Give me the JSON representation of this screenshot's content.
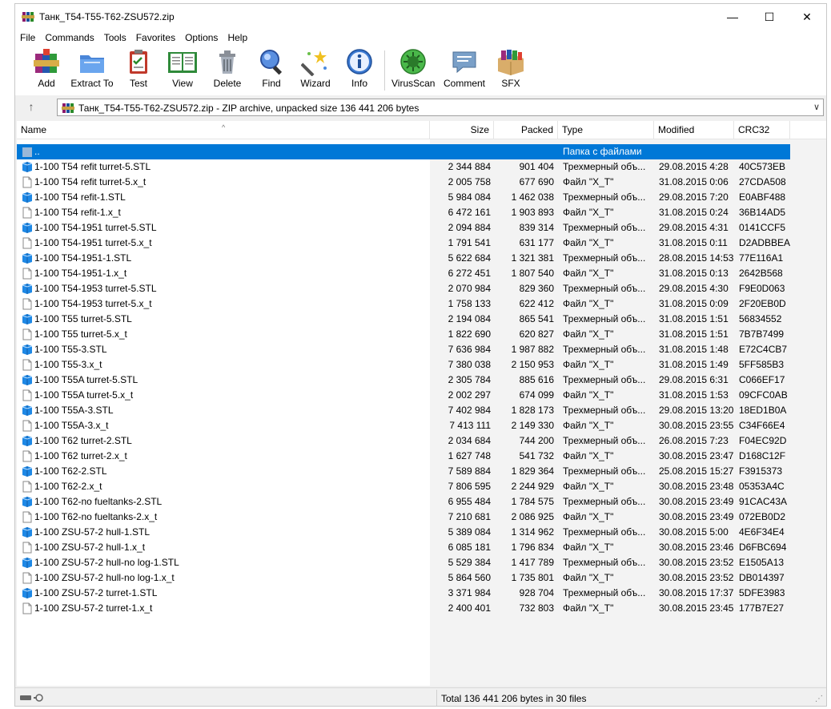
{
  "window": {
    "title": "Танк_T54-T55-T62-ZSU572.zip",
    "minimize": "—",
    "maximize": "☐",
    "close": "✕"
  },
  "menu": [
    "File",
    "Commands",
    "Tools",
    "Favorites",
    "Options",
    "Help"
  ],
  "toolbar": [
    {
      "label": "Add",
      "icon": "add-archive-icon"
    },
    {
      "label": "Extract To",
      "icon": "extract-folder-icon"
    },
    {
      "label": "Test",
      "icon": "test-clipboard-icon"
    },
    {
      "label": "View",
      "icon": "view-book-icon"
    },
    {
      "label": "Delete",
      "icon": "trash-icon"
    },
    {
      "label": "Find",
      "icon": "magnifier-icon"
    },
    {
      "label": "Wizard",
      "icon": "wizard-wand-icon"
    },
    {
      "label": "Info",
      "icon": "info-icon"
    },
    {
      "label": "VirusScan",
      "icon": "virus-scan-icon"
    },
    {
      "label": "Comment",
      "icon": "comment-icon"
    },
    {
      "label": "SFX",
      "icon": "sfx-box-icon"
    }
  ],
  "address": {
    "text": "Танк_T54-T55-T62-ZSU572.zip - ZIP archive, unpacked size 136 441 206 bytes"
  },
  "columns": {
    "name": "Name",
    "size": "Size",
    "packed": "Packed",
    "type": "Type",
    "modified": "Modified",
    "crc": "CRC32"
  },
  "parent_row": {
    "name": "..",
    "type": "Папка с файлами"
  },
  "files": [
    {
      "name": "1-100 T54 refit turret-5.STL",
      "size": "2 344 884",
      "packed": "901 404",
      "type": "Трехмерный объ...",
      "modified": "29.08.2015 4:28",
      "crc": "40C573EB",
      "kind": "stl"
    },
    {
      "name": "1-100 T54 refit turret-5.x_t",
      "size": "2 005 758",
      "packed": "677 690",
      "type": "Файл \"X_T\"",
      "modified": "31.08.2015 0:06",
      "crc": "27CDA508",
      "kind": "xt"
    },
    {
      "name": "1-100 T54 refit-1.STL",
      "size": "5 984 084",
      "packed": "1 462 038",
      "type": "Трехмерный объ...",
      "modified": "29.08.2015 7:20",
      "crc": "E0ABF488",
      "kind": "stl"
    },
    {
      "name": "1-100 T54 refit-1.x_t",
      "size": "6 472 161",
      "packed": "1 903 893",
      "type": "Файл \"X_T\"",
      "modified": "31.08.2015 0:24",
      "crc": "36B14AD5",
      "kind": "xt"
    },
    {
      "name": "1-100 T54-1951 turret-5.STL",
      "size": "2 094 884",
      "packed": "839 314",
      "type": "Трехмерный объ...",
      "modified": "29.08.2015 4:31",
      "crc": "0141CCF5",
      "kind": "stl"
    },
    {
      "name": "1-100 T54-1951 turret-5.x_t",
      "size": "1 791 541",
      "packed": "631 177",
      "type": "Файл \"X_T\"",
      "modified": "31.08.2015 0:11",
      "crc": "D2ADBBEA",
      "kind": "xt"
    },
    {
      "name": "1-100 T54-1951-1.STL",
      "size": "5 622 684",
      "packed": "1 321 381",
      "type": "Трехмерный объ...",
      "modified": "28.08.2015 14:53",
      "crc": "77E116A1",
      "kind": "stl"
    },
    {
      "name": "1-100 T54-1951-1.x_t",
      "size": "6 272 451",
      "packed": "1 807 540",
      "type": "Файл \"X_T\"",
      "modified": "31.08.2015 0:13",
      "crc": "2642B568",
      "kind": "xt"
    },
    {
      "name": "1-100 T54-1953 turret-5.STL",
      "size": "2 070 984",
      "packed": "829 360",
      "type": "Трехмерный объ...",
      "modified": "29.08.2015 4:30",
      "crc": "F9E0D063",
      "kind": "stl"
    },
    {
      "name": "1-100 T54-1953 turret-5.x_t",
      "size": "1 758 133",
      "packed": "622 412",
      "type": "Файл \"X_T\"",
      "modified": "31.08.2015 0:09",
      "crc": "2F20EB0D",
      "kind": "xt"
    },
    {
      "name": "1-100 T55 turret-5.STL",
      "size": "2 194 084",
      "packed": "865 541",
      "type": "Трехмерный объ...",
      "modified": "31.08.2015 1:51",
      "crc": "56834552",
      "kind": "stl"
    },
    {
      "name": "1-100 T55 turret-5.x_t",
      "size": "1 822 690",
      "packed": "620 827",
      "type": "Файл \"X_T\"",
      "modified": "31.08.2015 1:51",
      "crc": "7B7B7499",
      "kind": "xt"
    },
    {
      "name": "1-100 T55-3.STL",
      "size": "7 636 984",
      "packed": "1 987 882",
      "type": "Трехмерный объ...",
      "modified": "31.08.2015 1:48",
      "crc": "E72C4CB7",
      "kind": "stl"
    },
    {
      "name": "1-100 T55-3.x_t",
      "size": "7 380 038",
      "packed": "2 150 953",
      "type": "Файл \"X_T\"",
      "modified": "31.08.2015 1:49",
      "crc": "5FF585B3",
      "kind": "xt"
    },
    {
      "name": "1-100 T55A turret-5.STL",
      "size": "2 305 784",
      "packed": "885 616",
      "type": "Трехмерный объ...",
      "modified": "29.08.2015 6:31",
      "crc": "C066EF17",
      "kind": "stl"
    },
    {
      "name": "1-100 T55A turret-5.x_t",
      "size": "2 002 297",
      "packed": "674 099",
      "type": "Файл \"X_T\"",
      "modified": "31.08.2015 1:53",
      "crc": "09CFC0AB",
      "kind": "xt"
    },
    {
      "name": "1-100 T55A-3.STL",
      "size": "7 402 984",
      "packed": "1 828 173",
      "type": "Трехмерный объ...",
      "modified": "29.08.2015 13:20",
      "crc": "18ED1B0A",
      "kind": "stl"
    },
    {
      "name": "1-100 T55A-3.x_t",
      "size": "7 413 111",
      "packed": "2 149 330",
      "type": "Файл \"X_T\"",
      "modified": "30.08.2015 23:55",
      "crc": "C34F66E4",
      "kind": "xt"
    },
    {
      "name": "1-100 T62 turret-2.STL",
      "size": "2 034 684",
      "packed": "744 200",
      "type": "Трехмерный объ...",
      "modified": "26.08.2015 7:23",
      "crc": "F04EC92D",
      "kind": "stl"
    },
    {
      "name": "1-100 T62 turret-2.x_t",
      "size": "1 627 748",
      "packed": "541 732",
      "type": "Файл \"X_T\"",
      "modified": "30.08.2015 23:47",
      "crc": "D168C12F",
      "kind": "xt"
    },
    {
      "name": "1-100 T62-2.STL",
      "size": "7 589 884",
      "packed": "1 829 364",
      "type": "Трехмерный объ...",
      "modified": "25.08.2015 15:27",
      "crc": "F3915373",
      "kind": "stl"
    },
    {
      "name": "1-100 T62-2.x_t",
      "size": "7 806 595",
      "packed": "2 244 929",
      "type": "Файл \"X_T\"",
      "modified": "30.08.2015 23:48",
      "crc": "05353A4C",
      "kind": "xt"
    },
    {
      "name": "1-100 T62-no fueltanks-2.STL",
      "size": "6 955 484",
      "packed": "1 784 575",
      "type": "Трехмерный объ...",
      "modified": "30.08.2015 23:49",
      "crc": "91CAC43A",
      "kind": "stl"
    },
    {
      "name": "1-100 T62-no fueltanks-2.x_t",
      "size": "7 210 681",
      "packed": "2 086 925",
      "type": "Файл \"X_T\"",
      "modified": "30.08.2015 23:49",
      "crc": "072EB0D2",
      "kind": "xt"
    },
    {
      "name": "1-100 ZSU-57-2 hull-1.STL",
      "size": "5 389 084",
      "packed": "1 314 962",
      "type": "Трехмерный объ...",
      "modified": "30.08.2015 5:00",
      "crc": "4E6F34E4",
      "kind": "stl"
    },
    {
      "name": "1-100 ZSU-57-2 hull-1.x_t",
      "size": "6 085 181",
      "packed": "1 796 834",
      "type": "Файл \"X_T\"",
      "modified": "30.08.2015 23:46",
      "crc": "D6FBC694",
      "kind": "xt"
    },
    {
      "name": "1-100 ZSU-57-2 hull-no log-1.STL",
      "size": "5 529 384",
      "packed": "1 417 789",
      "type": "Трехмерный объ...",
      "modified": "30.08.2015 23:52",
      "crc": "E1505A13",
      "kind": "stl"
    },
    {
      "name": "1-100 ZSU-57-2 hull-no log-1.x_t",
      "size": "5 864 560",
      "packed": "1 735 801",
      "type": "Файл \"X_T\"",
      "modified": "30.08.2015 23:52",
      "crc": "DB014397",
      "kind": "xt"
    },
    {
      "name": "1-100 ZSU-57-2 turret-1.STL",
      "size": "3 371 984",
      "packed": "928 704",
      "type": "Трехмерный объ...",
      "modified": "30.08.2015 17:37",
      "crc": "5DFE3983",
      "kind": "stl"
    },
    {
      "name": "1-100 ZSU-57-2 turret-1.x_t",
      "size": "2 400 401",
      "packed": "732 803",
      "type": "Файл \"X_T\"",
      "modified": "30.08.2015 23:45",
      "crc": "177B7E27",
      "kind": "xt"
    }
  ],
  "status": {
    "total": "Total 136 441 206 bytes in 30 files"
  }
}
